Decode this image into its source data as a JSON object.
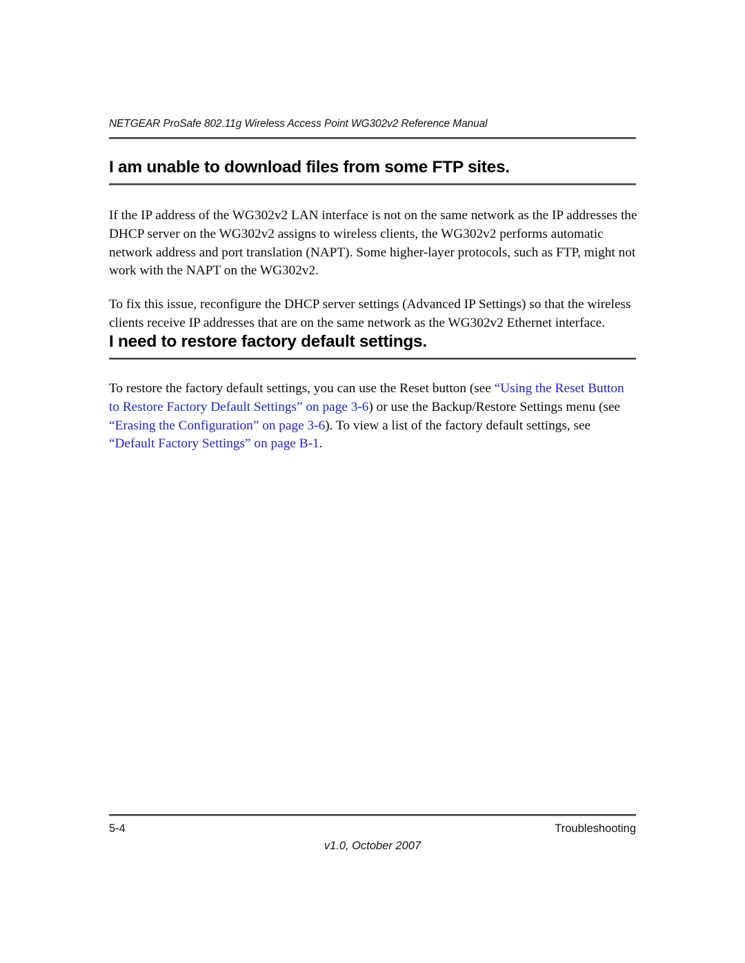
{
  "document": {
    "header_title": "NETGEAR ProSafe 802.11g Wireless Access Point WG302v2 Reference Manual",
    "link_color": "#2222CC",
    "text_color": "#000000"
  },
  "sections": [
    {
      "heading": "I am unable to download files from some FTP sites.",
      "paragraphs": [
        {
          "runs": [
            {
              "text": "If the IP address of the WG302v2 LAN interface is not on the same network as the IP addresses the DHCP server on the WG302v2 assigns to wireless clients, the WG302v2 performs automatic network address and port translation (NAPT). Some higher-layer protocols, such as FTP, might not work with the NAPT on the WG302v2.",
              "link": false
            }
          ]
        },
        {
          "runs": [
            {
              "text": "To fix this issue, reconfigure the DHCP server settings (Advanced IP Settings) so that the wireless clients receive IP addresses that are on the same network as the WG302v2 Ethernet interface.",
              "link": false
            }
          ]
        }
      ]
    },
    {
      "heading": "I need to restore factory default settings.",
      "paragraphs": [
        {
          "runs": [
            {
              "text": "To restore the factory default settings, you can use the Reset button (see ",
              "link": false
            },
            {
              "text": "“Using the Reset Button to Restore Factory Default Settings” on page 3-6",
              "link": true
            },
            {
              "text": ") or use the Backup/Restore Settings menu (see ",
              "link": false
            },
            {
              "text": "“Erasing the Configuration” on page 3-6",
              "link": true
            },
            {
              "text": "). To view a list of the factory default settings, see ",
              "link": false
            },
            {
              "text": "“Default Factory Settings” on page B-1",
              "link": true
            },
            {
              "text": ".",
              "link": false
            }
          ]
        }
      ]
    }
  ],
  "footer": {
    "page_number": "5-4",
    "chapter": "Troubleshooting",
    "version": "v1.0, October 2007"
  }
}
